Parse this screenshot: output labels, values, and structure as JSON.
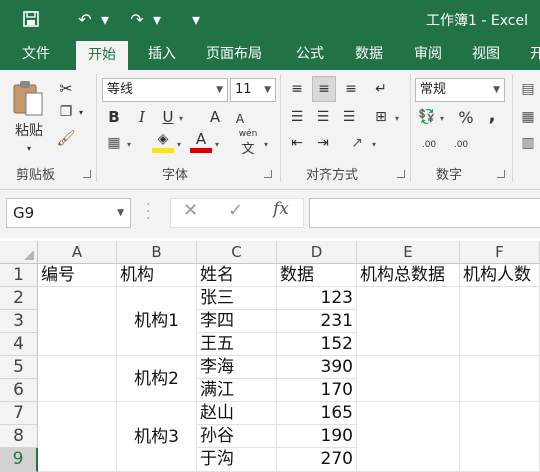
{
  "app": {
    "title": "工作簿1 - Excel"
  },
  "quick_access": {
    "save_icon": "floppy-disk-icon",
    "undo_icon": "undo-arrow-icon",
    "redo_icon": "redo-arrow-icon"
  },
  "tabs": [
    "文件",
    "开始",
    "插入",
    "页面布局",
    "公式",
    "数据",
    "审阅",
    "视图",
    "开"
  ],
  "ribbon": {
    "clipboard": {
      "paste_label": "粘贴",
      "group_label": "剪贴板"
    },
    "font": {
      "font_name": "等线",
      "font_size": "11",
      "bold": "B",
      "italic": "I",
      "underline": "U",
      "grow": "A",
      "shrink": "A",
      "wen": "wén",
      "wen_char": "文",
      "group_label": "字体"
    },
    "alignment": {
      "group_label": "对齐方式"
    },
    "number": {
      "format": "常规",
      "percent": "%",
      "comma": ",",
      "inc_decimal": ".00",
      "dec_decimal": ".00",
      "group_label": "数字"
    }
  },
  "formula_bar": {
    "name_box": "G9",
    "fx_label": "fx",
    "formula": ""
  },
  "sheet": {
    "columns": [
      "A",
      "B",
      "C",
      "D",
      "E",
      "F"
    ],
    "rows": [
      "1",
      "2",
      "3",
      "4",
      "5",
      "6",
      "7",
      "8",
      "9"
    ],
    "selected_row": "9",
    "headers": [
      "编号",
      "机构",
      "姓名",
      "数据",
      "机构总数据",
      "机构人数"
    ],
    "records": [
      {
        "name": "张三",
        "value": "123"
      },
      {
        "name": "李四",
        "value": "231"
      },
      {
        "name": "王五",
        "value": "152"
      },
      {
        "name": "李海",
        "value": "390"
      },
      {
        "name": "满江",
        "value": "170"
      },
      {
        "name": "赵山",
        "value": "165"
      },
      {
        "name": "孙谷",
        "value": "190"
      },
      {
        "name": "于沟",
        "value": "270"
      }
    ],
    "groups": [
      "机构1",
      "机构2",
      "机构3"
    ]
  },
  "colors": {
    "excel_green": "#217346",
    "ribbon_bg": "#f3f3f3"
  }
}
